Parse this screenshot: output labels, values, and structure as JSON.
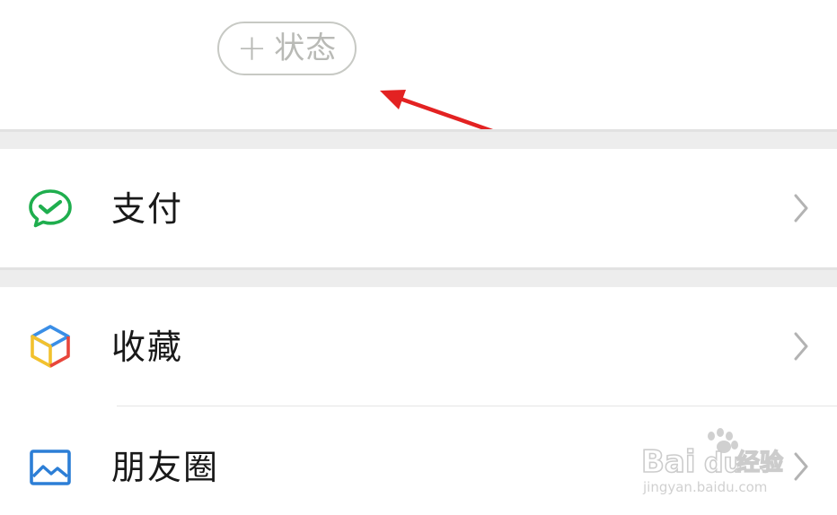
{
  "status_button": {
    "plus": "+",
    "label": "状态"
  },
  "menu": {
    "pay": {
      "label": "支付",
      "icon": "wechat-pay-icon"
    },
    "favorites": {
      "label": "收藏",
      "icon": "favorites-cube-icon"
    },
    "moments": {
      "label": "朋友圈",
      "icon": "moments-picture-icon"
    }
  },
  "watermark": {
    "brand": "Bai",
    "brand2": "du",
    "suffix": "经验",
    "url": "jingyan.baidu.com"
  },
  "colors": {
    "arrow": "#e32222",
    "pay_green": "#1fae4e",
    "text": "#191919",
    "chevron": "#b3b3b3",
    "band": "#ededed"
  }
}
